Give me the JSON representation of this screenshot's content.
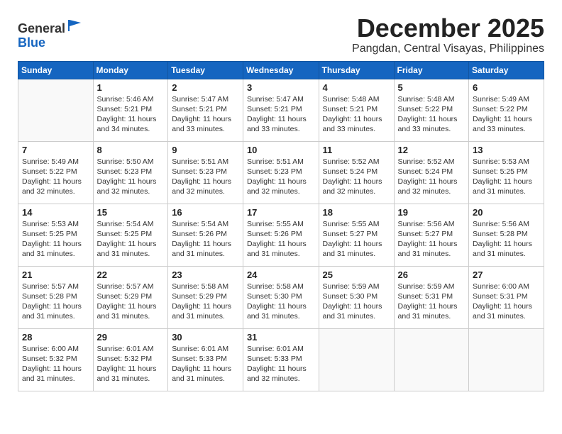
{
  "header": {
    "logo_general": "General",
    "logo_blue": "Blue",
    "month_title": "December 2025",
    "location": "Pangdan, Central Visayas, Philippines"
  },
  "columns": [
    "Sunday",
    "Monday",
    "Tuesday",
    "Wednesday",
    "Thursday",
    "Friday",
    "Saturday"
  ],
  "weeks": [
    [
      {
        "day": "",
        "info": ""
      },
      {
        "day": "1",
        "info": "Sunrise: 5:46 AM\nSunset: 5:21 PM\nDaylight: 11 hours\nand 34 minutes."
      },
      {
        "day": "2",
        "info": "Sunrise: 5:47 AM\nSunset: 5:21 PM\nDaylight: 11 hours\nand 33 minutes."
      },
      {
        "day": "3",
        "info": "Sunrise: 5:47 AM\nSunset: 5:21 PM\nDaylight: 11 hours\nand 33 minutes."
      },
      {
        "day": "4",
        "info": "Sunrise: 5:48 AM\nSunset: 5:21 PM\nDaylight: 11 hours\nand 33 minutes."
      },
      {
        "day": "5",
        "info": "Sunrise: 5:48 AM\nSunset: 5:22 PM\nDaylight: 11 hours\nand 33 minutes."
      },
      {
        "day": "6",
        "info": "Sunrise: 5:49 AM\nSunset: 5:22 PM\nDaylight: 11 hours\nand 33 minutes."
      }
    ],
    [
      {
        "day": "7",
        "info": "Sunrise: 5:49 AM\nSunset: 5:22 PM\nDaylight: 11 hours\nand 32 minutes."
      },
      {
        "day": "8",
        "info": "Sunrise: 5:50 AM\nSunset: 5:23 PM\nDaylight: 11 hours\nand 32 minutes."
      },
      {
        "day": "9",
        "info": "Sunrise: 5:51 AM\nSunset: 5:23 PM\nDaylight: 11 hours\nand 32 minutes."
      },
      {
        "day": "10",
        "info": "Sunrise: 5:51 AM\nSunset: 5:23 PM\nDaylight: 11 hours\nand 32 minutes."
      },
      {
        "day": "11",
        "info": "Sunrise: 5:52 AM\nSunset: 5:24 PM\nDaylight: 11 hours\nand 32 minutes."
      },
      {
        "day": "12",
        "info": "Sunrise: 5:52 AM\nSunset: 5:24 PM\nDaylight: 11 hours\nand 32 minutes."
      },
      {
        "day": "13",
        "info": "Sunrise: 5:53 AM\nSunset: 5:25 PM\nDaylight: 11 hours\nand 31 minutes."
      }
    ],
    [
      {
        "day": "14",
        "info": "Sunrise: 5:53 AM\nSunset: 5:25 PM\nDaylight: 11 hours\nand 31 minutes."
      },
      {
        "day": "15",
        "info": "Sunrise: 5:54 AM\nSunset: 5:25 PM\nDaylight: 11 hours\nand 31 minutes."
      },
      {
        "day": "16",
        "info": "Sunrise: 5:54 AM\nSunset: 5:26 PM\nDaylight: 11 hours\nand 31 minutes."
      },
      {
        "day": "17",
        "info": "Sunrise: 5:55 AM\nSunset: 5:26 PM\nDaylight: 11 hours\nand 31 minutes."
      },
      {
        "day": "18",
        "info": "Sunrise: 5:55 AM\nSunset: 5:27 PM\nDaylight: 11 hours\nand 31 minutes."
      },
      {
        "day": "19",
        "info": "Sunrise: 5:56 AM\nSunset: 5:27 PM\nDaylight: 11 hours\nand 31 minutes."
      },
      {
        "day": "20",
        "info": "Sunrise: 5:56 AM\nSunset: 5:28 PM\nDaylight: 11 hours\nand 31 minutes."
      }
    ],
    [
      {
        "day": "21",
        "info": "Sunrise: 5:57 AM\nSunset: 5:28 PM\nDaylight: 11 hours\nand 31 minutes."
      },
      {
        "day": "22",
        "info": "Sunrise: 5:57 AM\nSunset: 5:29 PM\nDaylight: 11 hours\nand 31 minutes."
      },
      {
        "day": "23",
        "info": "Sunrise: 5:58 AM\nSunset: 5:29 PM\nDaylight: 11 hours\nand 31 minutes."
      },
      {
        "day": "24",
        "info": "Sunrise: 5:58 AM\nSunset: 5:30 PM\nDaylight: 11 hours\nand 31 minutes."
      },
      {
        "day": "25",
        "info": "Sunrise: 5:59 AM\nSunset: 5:30 PM\nDaylight: 11 hours\nand 31 minutes."
      },
      {
        "day": "26",
        "info": "Sunrise: 5:59 AM\nSunset: 5:31 PM\nDaylight: 11 hours\nand 31 minutes."
      },
      {
        "day": "27",
        "info": "Sunrise: 6:00 AM\nSunset: 5:31 PM\nDaylight: 11 hours\nand 31 minutes."
      }
    ],
    [
      {
        "day": "28",
        "info": "Sunrise: 6:00 AM\nSunset: 5:32 PM\nDaylight: 11 hours\nand 31 minutes."
      },
      {
        "day": "29",
        "info": "Sunrise: 6:01 AM\nSunset: 5:32 PM\nDaylight: 11 hours\nand 31 minutes."
      },
      {
        "day": "30",
        "info": "Sunrise: 6:01 AM\nSunset: 5:33 PM\nDaylight: 11 hours\nand 31 minutes."
      },
      {
        "day": "31",
        "info": "Sunrise: 6:01 AM\nSunset: 5:33 PM\nDaylight: 11 hours\nand 32 minutes."
      },
      {
        "day": "",
        "info": ""
      },
      {
        "day": "",
        "info": ""
      },
      {
        "day": "",
        "info": ""
      }
    ]
  ]
}
